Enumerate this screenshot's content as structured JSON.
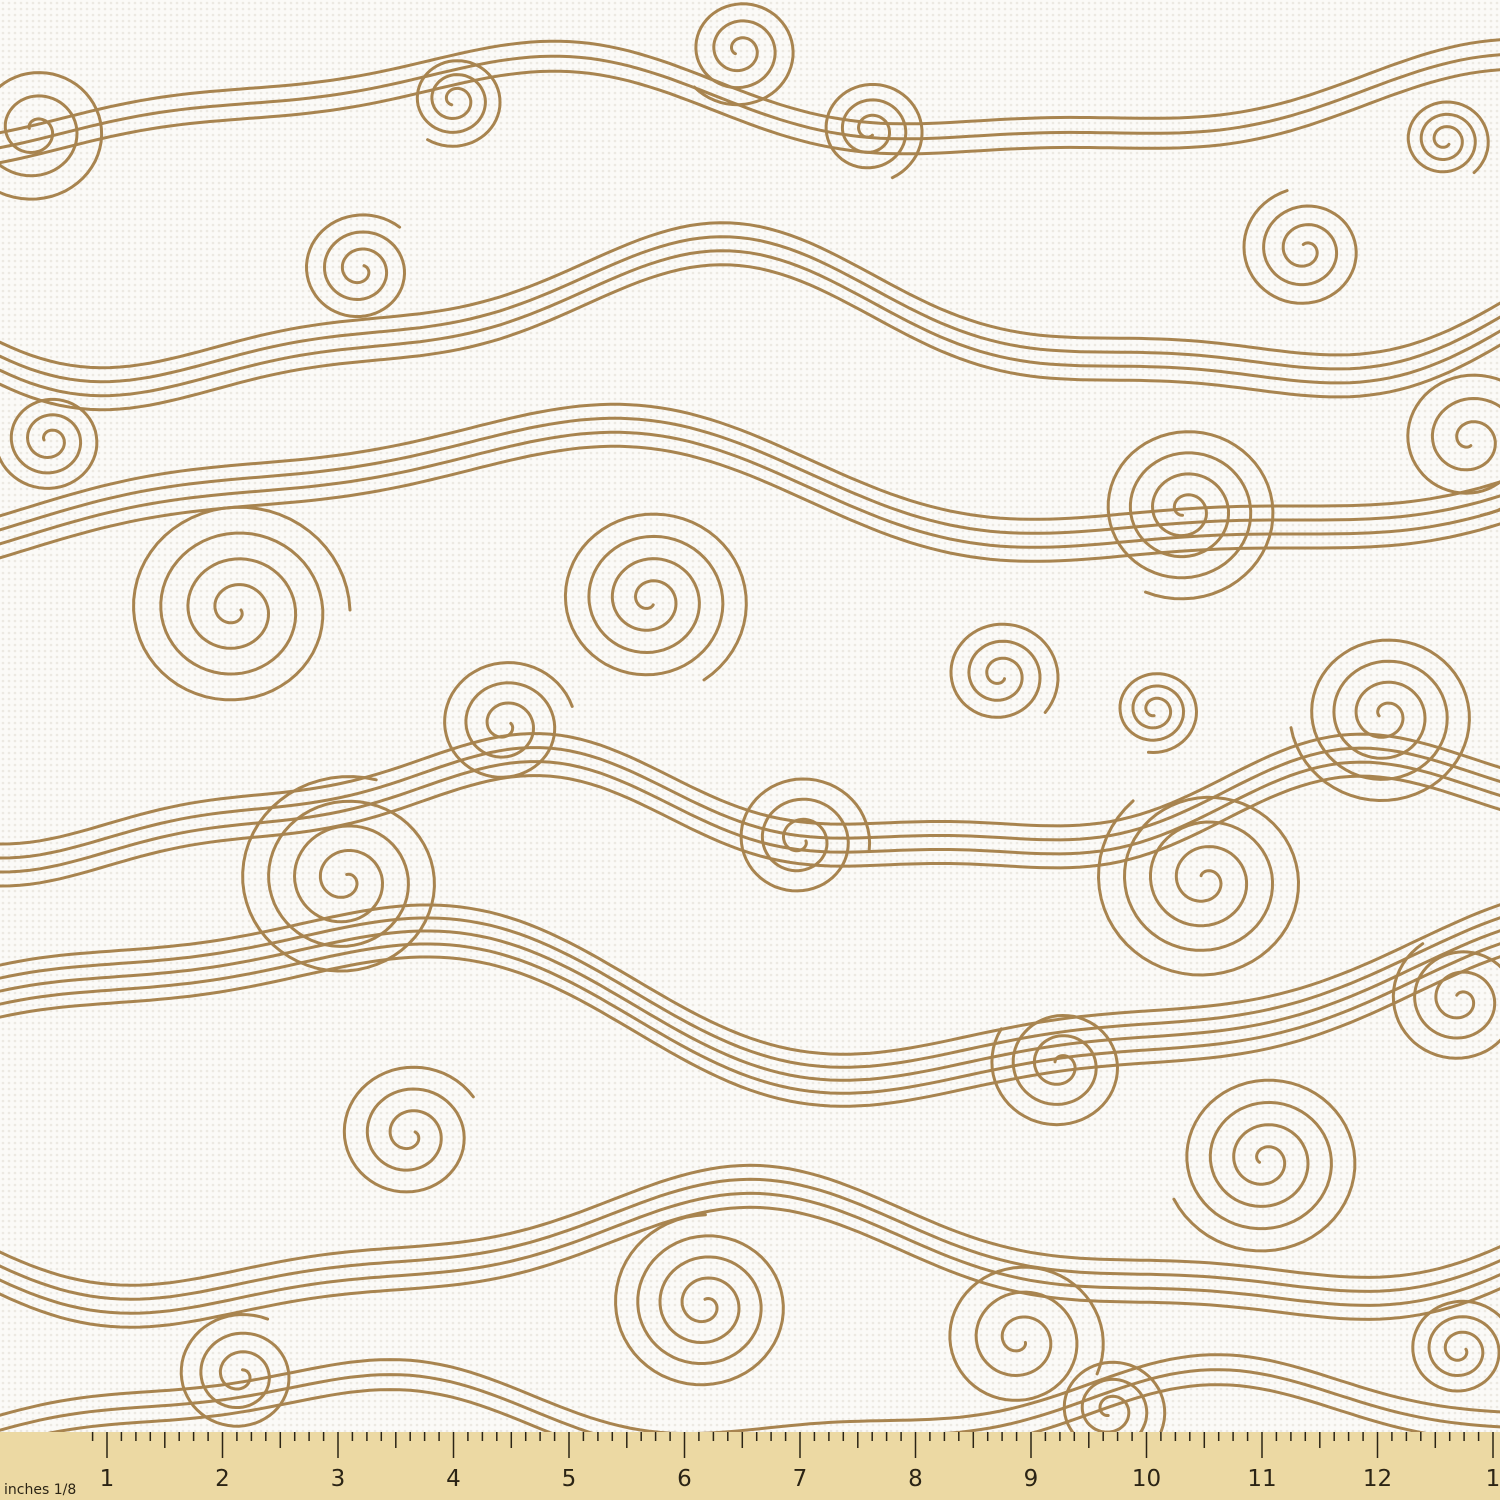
{
  "colors": {
    "fabric_background": "#fbfaf7",
    "weave_texture": "#ece9e2",
    "line_color": "#a8844f",
    "ruler_background": "#ecd9a3",
    "ruler_text": "#2b2415"
  },
  "pattern": {
    "style": "hand-drawn swirl and wave outlines on white woven fabric"
  },
  "ruler": {
    "unit_label": "inches 1/8",
    "numbers": [
      "1",
      "2",
      "3",
      "4",
      "5",
      "6",
      "7",
      "8",
      "9",
      "10",
      "11",
      "12",
      "1"
    ]
  }
}
